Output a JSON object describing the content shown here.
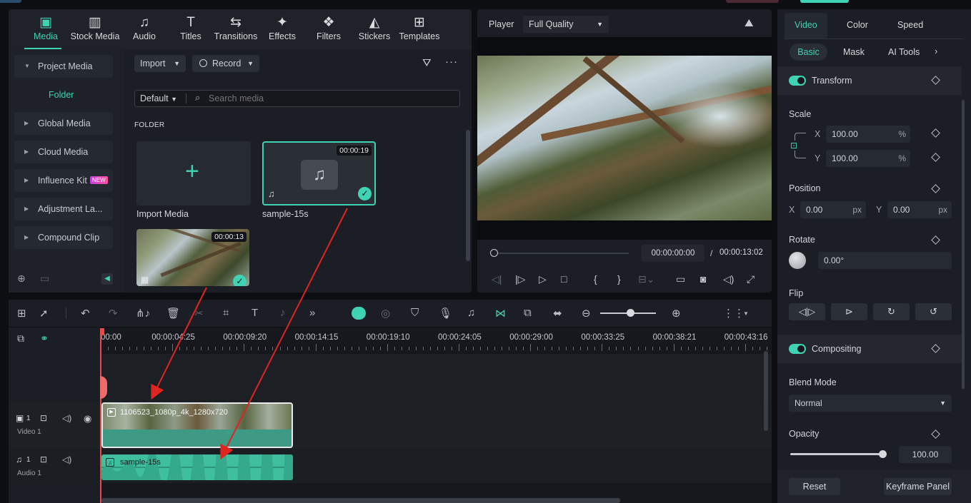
{
  "top_tabs": [
    {
      "label": "Media",
      "icon": "media-icon",
      "glyph": "▣",
      "active": true
    },
    {
      "label": "Stock Media",
      "icon": "stock-media-icon",
      "glyph": "▥"
    },
    {
      "label": "Audio",
      "icon": "audio-icon",
      "glyph": "♫"
    },
    {
      "label": "Titles",
      "icon": "titles-icon",
      "glyph": "T"
    },
    {
      "label": "Transitions",
      "icon": "transitions-icon",
      "glyph": "⇆"
    },
    {
      "label": "Effects",
      "icon": "effects-icon",
      "glyph": "✦"
    },
    {
      "label": "Filters",
      "icon": "filters-icon",
      "glyph": "❖"
    },
    {
      "label": "Stickers",
      "icon": "stickers-icon",
      "glyph": "◭"
    },
    {
      "label": "Templates",
      "icon": "templates-icon",
      "glyph": "⊞"
    }
  ],
  "left_menu": {
    "project_media": "Project Media",
    "folder": "Folder",
    "items": [
      "Global Media",
      "Cloud Media",
      "Influence Kit",
      "Adjustment La...",
      "Compound Clip"
    ],
    "new_badge": "NEW"
  },
  "media_toolbar": {
    "import": "Import",
    "record": "Record",
    "sort": "Default",
    "search_placeholder": "Search media"
  },
  "media_grid": {
    "section": "FOLDER",
    "import_label": "Import Media",
    "audio_item": {
      "name": "sample-15s",
      "duration": "00:00:19"
    },
    "video_item": {
      "duration": "00:00:13"
    }
  },
  "player": {
    "label": "Player",
    "quality": "Full Quality",
    "current": "00:00:00:00",
    "separator": "/",
    "total": "00:00:13:02"
  },
  "right_tabs": {
    "video": "Video",
    "color": "Color",
    "speed": "Speed"
  },
  "right_subtabs": {
    "basic": "Basic",
    "mask": "Mask",
    "ai_tools": "AI Tools"
  },
  "props": {
    "transform": "Transform",
    "scale": "Scale",
    "x": "X",
    "y": "Y",
    "scale_x": "100.00",
    "scale_y": "100.00",
    "percent": "%",
    "position": "Position",
    "pos_x": "0.00",
    "pos_y": "0.00",
    "px": "px",
    "rotate": "Rotate",
    "rotate_val": "0.00°",
    "flip": "Flip",
    "compositing": "Compositing",
    "blend_mode": "Blend Mode",
    "blend_val": "Normal",
    "opacity": "Opacity",
    "opacity_val": "100.00",
    "opacity_level": 1.0,
    "reset": "Reset",
    "keyframe_panel": "Keyframe Panel"
  },
  "timeline": {
    "ticks": [
      "00:00",
      "00:00:04:25",
      "00:00:09:20",
      "00:00:14:15",
      "00:00:19:10",
      "00:00:24:05",
      "00:00:29:00",
      "00:00:33:25",
      "00:00:38:21",
      "00:00:43:16"
    ],
    "video_track": "Video 1",
    "audio_track": "Audio 1",
    "track_num": "1",
    "video_clip": "1106523_1080p_4k_1280x720",
    "audio_clip": "sample-15s"
  },
  "colors": {
    "accent": "#3fd3b4",
    "arrow": "#e0241f",
    "playhead": "#e84a4a"
  }
}
